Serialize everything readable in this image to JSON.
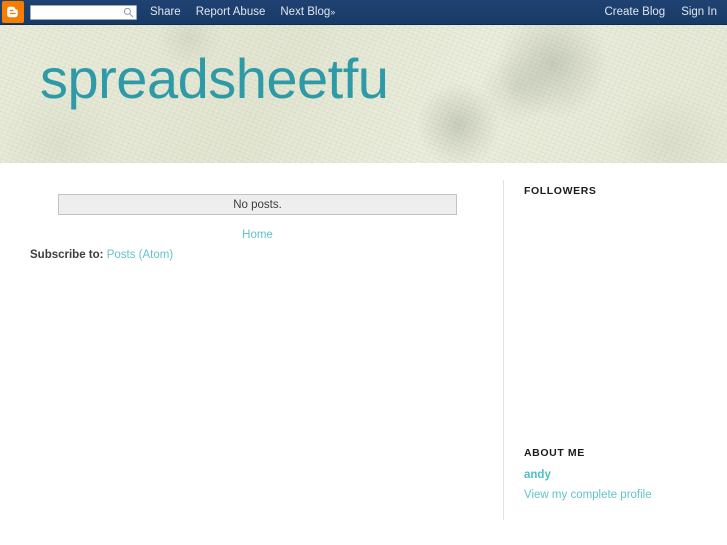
{
  "navbar": {
    "logo_icon": "blogger-b-icon",
    "search": {
      "value": "",
      "placeholder": "",
      "icon": "search-icon"
    },
    "left_links": [
      {
        "label": "Share"
      },
      {
        "label": "Report Abuse"
      },
      {
        "label": "Next Blog",
        "suffix": "»"
      }
    ],
    "right_links": [
      {
        "label": "Create Blog"
      },
      {
        "label": "Sign In"
      }
    ]
  },
  "header": {
    "blog_title": "spreadsheetfu",
    "title_color": "#2e9aa8",
    "background_color": "#e4e7d3"
  },
  "main": {
    "no_posts_message": "No posts.",
    "home_link": "Home",
    "subscribe_label": "Subscribe to:",
    "subscribe_link": "Posts (Atom)"
  },
  "sidebar": {
    "followers": {
      "title": "FOLLOWERS"
    },
    "about_me": {
      "title": "ABOUT ME",
      "profile_name": "andy",
      "profile_link": "View my complete profile"
    }
  },
  "colors": {
    "navbar_bg": "#1b3f6e",
    "blogger_orange": "#f57d00",
    "link_teal": "#63c3cb",
    "title_teal": "#2e9aa8"
  }
}
